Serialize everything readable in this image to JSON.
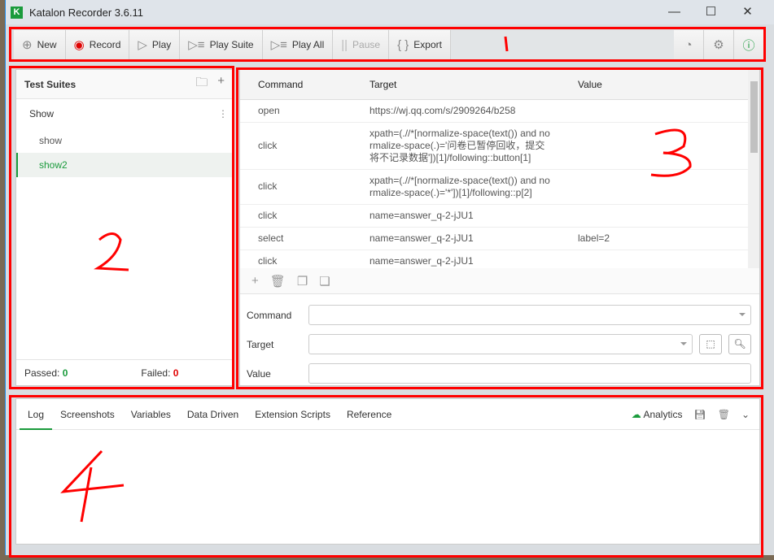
{
  "app": {
    "title": "Katalon Recorder 3.6.11",
    "logo": "K"
  },
  "toolbar": {
    "buttons": [
      {
        "label": "New",
        "icon": "plus-circle-icon",
        "glyph": "⊕"
      },
      {
        "label": "Record",
        "icon": "record-icon",
        "glyph": "◉"
      },
      {
        "label": "Play",
        "icon": "play-icon",
        "glyph": "▷"
      },
      {
        "label": "Play Suite",
        "icon": "play-suite-icon",
        "glyph": "▷☰"
      },
      {
        "label": "Play All",
        "icon": "play-all-icon",
        "glyph": "▷☰"
      },
      {
        "label": "Pause",
        "icon": "pause-icon",
        "glyph": "||"
      },
      {
        "label": "Export",
        "icon": "braces-icon",
        "glyph": "{ }"
      }
    ],
    "right_icons": [
      "speedometer-icon",
      "gear-icon",
      "help-icon"
    ]
  },
  "test_suites": {
    "title": "Test Suites",
    "suite": "Show",
    "cases": [
      "show",
      "show2"
    ],
    "selected": "show2",
    "passed_label": "Passed:",
    "passed": "0",
    "failed_label": "Failed:",
    "failed": "0"
  },
  "commands": {
    "headers": [
      "Command",
      "Target",
      "Value"
    ],
    "rows": [
      [
        "open",
        "https://wj.qq.com/s/2909264/b258",
        ""
      ],
      [
        "click",
        "xpath=(.//*[normalize-space(text()) and normalize-space(.)='问卷已暂停回收，提交将不记录数据'])[1]/following::button[1]",
        ""
      ],
      [
        "click",
        "xpath=(.//*[normalize-space(text()) and normalize-space(.)='*'])[1]/following::p[2]",
        ""
      ],
      [
        "click",
        "name=answer_q-2-jJU1",
        ""
      ],
      [
        "select",
        "name=answer_q-2-jJU1",
        "label=2"
      ],
      [
        "click",
        "name=answer_q-2-jJU1",
        ""
      ]
    ],
    "form": {
      "command_label": "Command",
      "target_label": "Target",
      "value_label": "Value",
      "command": "",
      "target": "",
      "value": ""
    }
  },
  "bottom": {
    "tabs": [
      "Log",
      "Screenshots",
      "Variables",
      "Data Driven",
      "Extension Scripts",
      "Reference"
    ],
    "active": "Log",
    "analytics": "Analytics"
  },
  "annotations": [
    "1",
    "2",
    "3",
    "4"
  ],
  "colors": {
    "accent": "#1a9b3c",
    "record": "#e00000",
    "annotation": "#ff0000"
  }
}
